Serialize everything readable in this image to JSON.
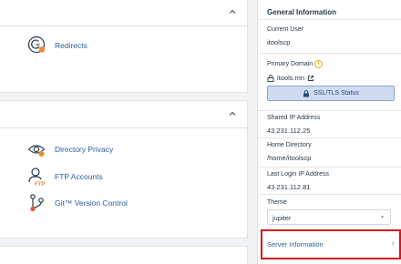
{
  "groups": [
    {
      "items": [
        {
          "label": "Redirects",
          "icon": "redirects-icon"
        }
      ]
    },
    {
      "items": [
        {
          "label": "Directory Privacy",
          "icon": "directory-privacy-icon"
        },
        {
          "label": "FTP Accounts",
          "icon": "ftp-accounts-icon"
        },
        {
          "label": "Git™ Version Control",
          "icon": "git-version-control-icon"
        }
      ]
    }
  ],
  "sidebar": {
    "title": "General Information",
    "current_user_label": "Current User",
    "current_user": "itoolscp",
    "primary_domain_label": "Primary Domain",
    "primary_domain": "itools.mn",
    "ssl_button": "SSL/TLS Status",
    "shared_ip_label": "Shared IP Address",
    "shared_ip": "43.231.112.25",
    "home_dir_label": "Home Directory",
    "home_dir": "/home/itoolscp",
    "last_login_label": "Last Login IP Address",
    "last_login": "43.231.112.81",
    "theme_label": "Theme",
    "theme_value": "jupiter",
    "server_info": "Server Information"
  },
  "colors": {
    "link": "#2b5d9c",
    "highlight": "#d4161b",
    "warning": "#e0a91c"
  }
}
